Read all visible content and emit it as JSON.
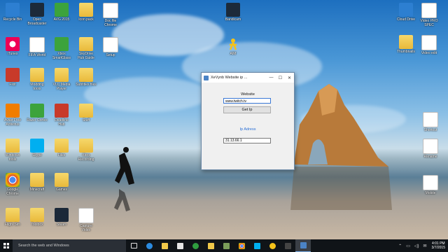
{
  "desktop": {
    "icons": [
      {
        "label": "Recycle Bin",
        "glyph": "g-blue"
      },
      {
        "label": "Open Broadcaster",
        "glyph": "g-dark"
      },
      {
        "label": "AVG 2015",
        "glyph": "g-green"
      },
      {
        "label": "Icon pack",
        "glyph": "g-folder"
      },
      {
        "label": "Doc file Chrome",
        "glyph": "g-doc"
      },
      {
        "label": "Bandicam",
        "glyph": "g-dark"
      },
      {
        "label": "iTunes",
        "glyph": "g-itunes"
      },
      {
        "label": "FIFA World",
        "glyph": "g-doc"
      },
      {
        "label": "Xbox SmartGlass",
        "glyph": "g-green"
      },
      {
        "label": "SkyDrive Hub Guide",
        "glyph": "g-folder"
      },
      {
        "label": "Setup",
        "glyph": "g-doc"
      },
      {
        "label": "AIM",
        "glyph": "g-aim"
      },
      {
        "label": "Fixit",
        "glyph": "g-red"
      },
      {
        "label": "Modding tools",
        "glyph": "g-folder"
      },
      {
        "label": "VLC Media Player",
        "glyph": "g-folder"
      },
      {
        "label": "Subtitles files",
        "glyph": "g-folder"
      },
      {
        "label": "Avast Free Antivirus",
        "glyph": "g-avast"
      },
      {
        "label": "Razer Cortex",
        "glyph": "g-green"
      },
      {
        "label": "Deadline Hub",
        "glyph": "g-red"
      },
      {
        "label": "Stuff",
        "glyph": "g-folder"
      },
      {
        "label": "Windows tools",
        "glyph": "g-folder"
      },
      {
        "label": "Skype",
        "glyph": "g-skype"
      },
      {
        "label": "Files",
        "glyph": "g-folder"
      },
      {
        "label": "Xbox Recording",
        "glyph": "g-folder"
      },
      {
        "label": "Google Chrome",
        "glyph": "g-chrome"
      },
      {
        "label": "Minecraft",
        "glyph": "g-folder"
      },
      {
        "label": "Games",
        "glyph": "g-folder"
      },
      {
        "label": "Flight Sim",
        "glyph": "g-folder"
      },
      {
        "label": "Toolbox",
        "glyph": "g-folder"
      },
      {
        "label": "Steam",
        "glyph": "g-steam"
      },
      {
        "label": "Capture Video",
        "glyph": "g-doc"
      },
      {
        "label": "Cloud Drive",
        "glyph": "g-blue"
      },
      {
        "label": "Video PRO SPEC",
        "glyph": "g-doc"
      },
      {
        "label": "Thumbnails",
        "glyph": "g-folder"
      },
      {
        "label": "Video edit",
        "glyph": "g-doc"
      },
      {
        "label": "Shortcut",
        "glyph": "g-doc"
      },
      {
        "label": "Rename",
        "glyph": "g-doc"
      },
      {
        "label": "Mobile",
        "glyph": "g-doc"
      }
    ]
  },
  "dialog": {
    "title": "XeVynb Website ip ...",
    "minimize": "—",
    "maximize": "☐",
    "close": "✕",
    "website_label": "Website",
    "website_value": "www.twitch.tv",
    "button_label": "Get Ip",
    "ip_label": "Ip Adress",
    "ip_value": "31.13.66.1"
  },
  "taskbar": {
    "search_placeholder": "Search the web and Windows",
    "time": "4:01 PM",
    "date": "3/7/2015",
    "tray_up": "⌃",
    "tray_icons": [
      "▭",
      "◁)",
      "✉"
    ]
  }
}
